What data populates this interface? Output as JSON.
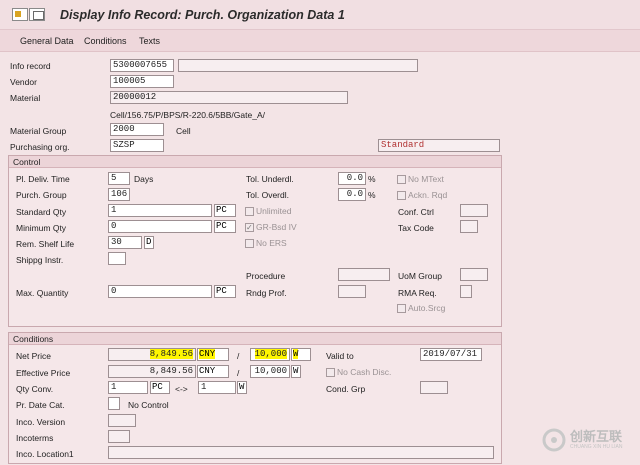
{
  "title": "Display Info Record: Purch. Organization Data 1",
  "menu": [
    "General Data",
    "Conditions",
    "Texts"
  ],
  "header": {
    "info_record_label": "Info record",
    "info_record": "5300007655",
    "vendor_label": "Vendor",
    "vendor": "100005",
    "material_label": "Material",
    "material": "20000012",
    "material_desc": "Cell/156.75/P/BPS/R-220.6/5BB/Gate_A/",
    "material_group_label": "Material Group",
    "material_group": "2000",
    "material_group_text": "Cell",
    "purch_org_label": "Purchasing org.",
    "purch_org": "SZSP",
    "category": "Standard"
  },
  "control": {
    "title": "Control",
    "pl_deliv_label": "Pl. Deliv. Time",
    "pl_deliv": "5",
    "pl_deliv_unit": "Days",
    "purch_group_label": "Purch. Group",
    "purch_group": "106",
    "std_qty_label": "Standard Qty",
    "std_qty": "1",
    "std_qty_unit": "PC",
    "min_qty_label": "Minimum Qty",
    "min_qty": "0",
    "min_qty_unit": "PC",
    "shelf_life_label": "Rem. Shelf Life",
    "shelf_life": "30",
    "shelf_life_unit": "D",
    "shipping_label": "Shippg Instr.",
    "max_qty_label": "Max. Quantity",
    "max_qty": "0",
    "max_qty_unit": "PC",
    "tol_under_label": "Tol. Underdl.",
    "tol_under": "0.0",
    "tol_under_pct": "%",
    "tol_over_label": "Tol. Overdl.",
    "tol_over": "0.0",
    "tol_over_pct": "%",
    "unlimited_label": "Unlimited",
    "gr_bsd_label": "GR-Bsd IV",
    "no_ers_label": "No ERS",
    "procedure_label": "Procedure",
    "rndg_label": "Rndg Prof.",
    "no_mtext_label": "No MText",
    "ackn_label": "Ackn. Rqd",
    "conf_ctrl_label": "Conf. Ctrl",
    "tax_code_label": "Tax Code",
    "uom_group_label": "UoM Group",
    "rma_label": "RMA Req.",
    "auto_srcg_label": "Auto.Srcg"
  },
  "conditions": {
    "title": "Conditions",
    "net_price_label": "Net Price",
    "net_price": "8,849.56",
    "net_price_cur": "CNY",
    "net_per": "10,000",
    "net_per_unit": "W",
    "eff_price_label": "Effective Price",
    "eff_price": "8,849.56",
    "eff_price_cur": "CNY",
    "eff_per": "10,000",
    "eff_per_unit": "W",
    "slash": "/",
    "valid_to_label": "Valid to",
    "valid_to": "2019/07/31",
    "no_cash_label": "No Cash Disc.",
    "qty_conv_label": "Qty Conv.",
    "qty_conv_a": "1",
    "qty_conv_a_unit": "PC",
    "qty_conv_arrow": "<->",
    "qty_conv_b": "1",
    "qty_conv_b_unit": "W",
    "cond_grp_label": "Cond. Grp",
    "pr_date_label": "Pr. Date Cat.",
    "pr_date_text": "No Control",
    "inco_version_label": "Inco. Version",
    "incoterms_label": "Incoterms",
    "inco_loc_label": "Inco. Location1"
  },
  "watermark_text": "创新互联",
  "watermark_sub": "CHUANG XIN HU LIAN"
}
